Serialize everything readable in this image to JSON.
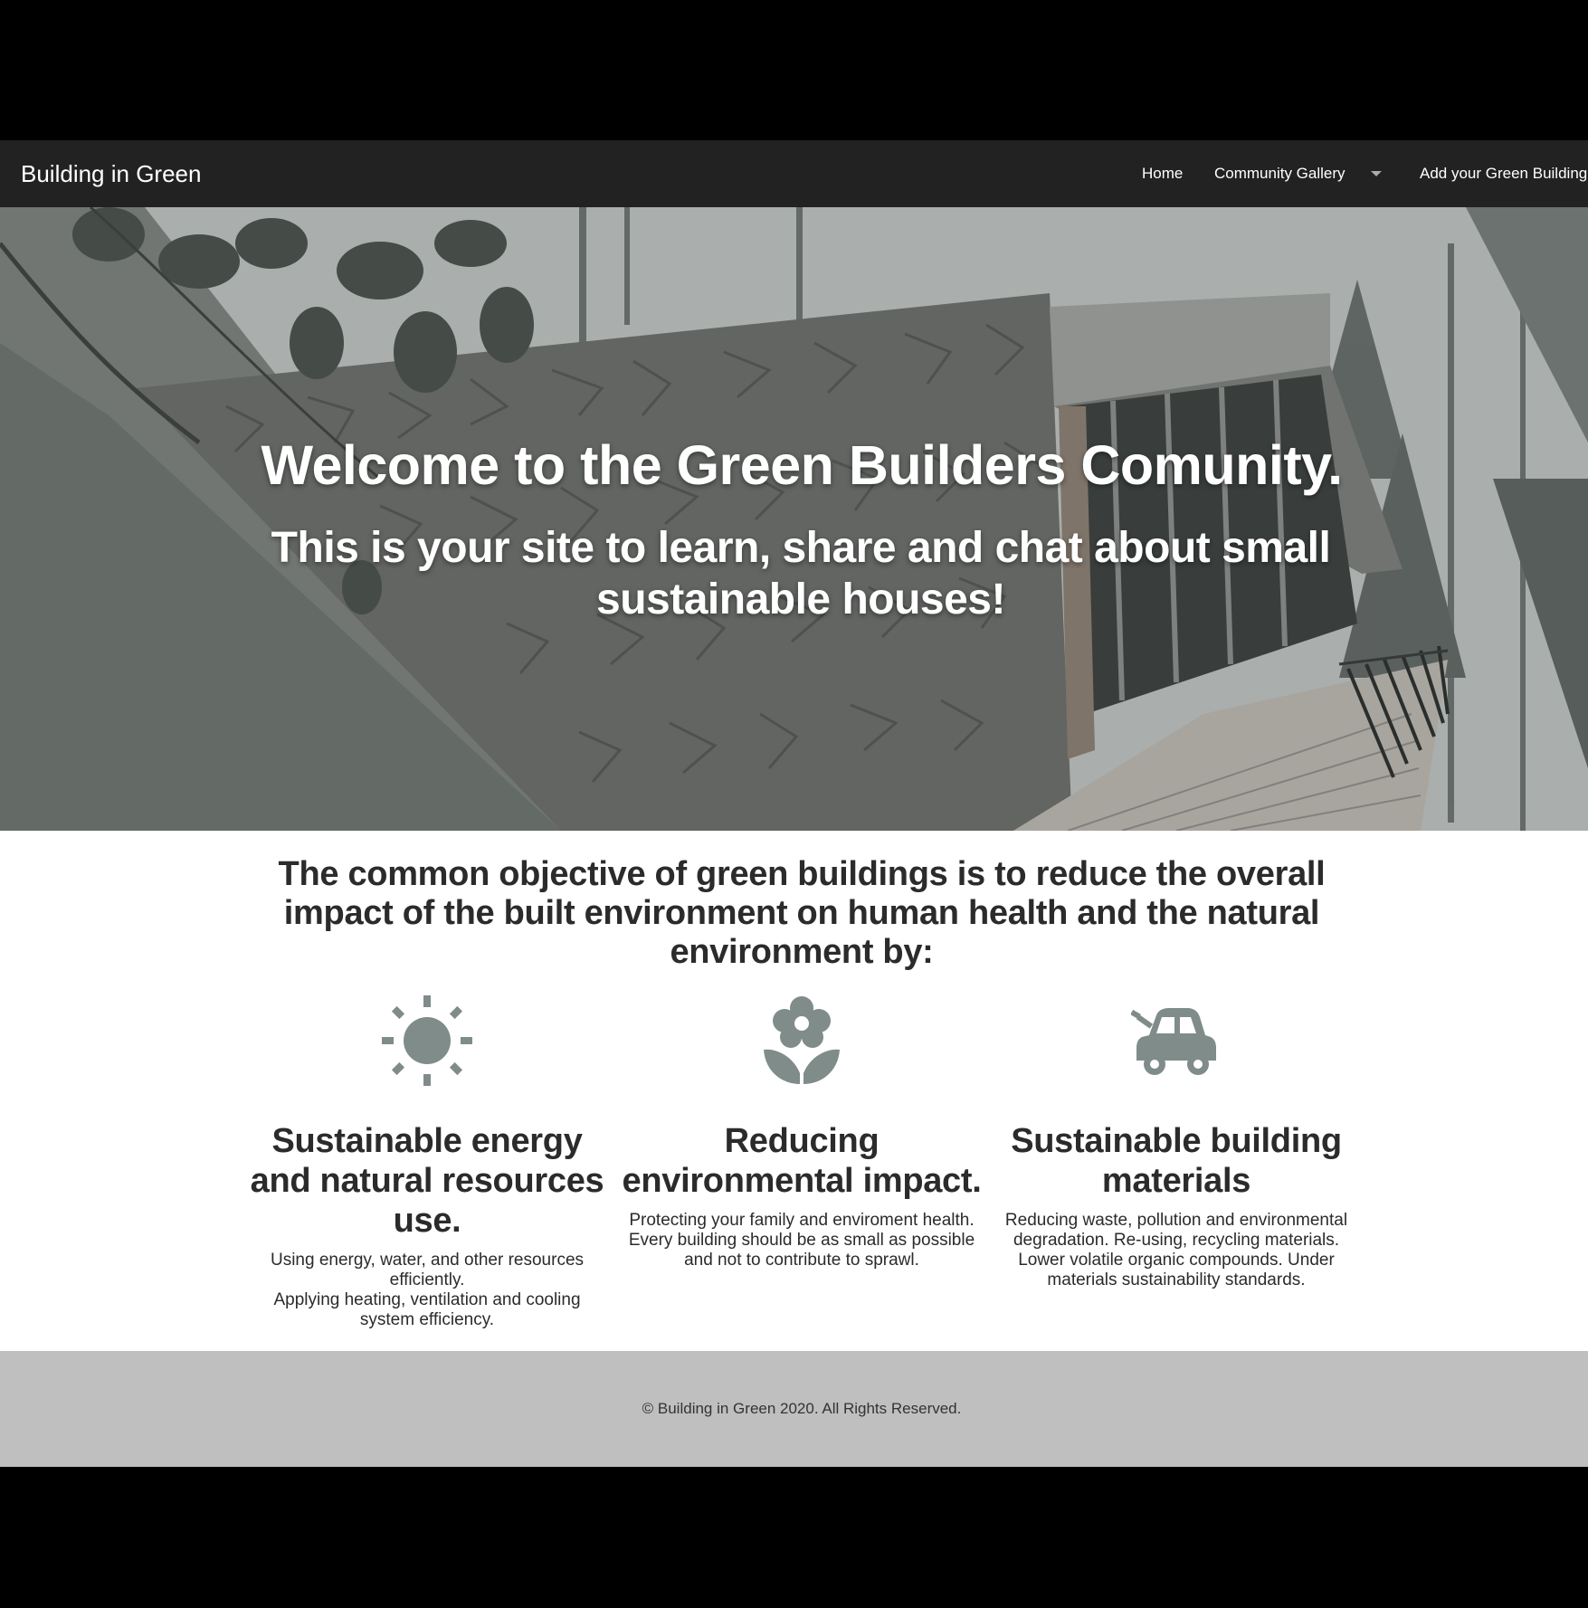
{
  "navbar": {
    "brand": "Building in Green",
    "items": [
      {
        "label": "Home"
      },
      {
        "label": "Community Gallery",
        "has_dropdown": true
      },
      {
        "label": "Add your Green Building"
      }
    ]
  },
  "hero": {
    "title": "Welcome to the Green Builders Comunity.",
    "subtitle": "This is your site to learn, share and chat about small sustainable houses!"
  },
  "intro": {
    "text": "The common objective of green buildings is to reduce the overall impact of the built environment on human health and the natural environment by:"
  },
  "features": [
    {
      "icon": "sun-icon",
      "title": "Sustainable energy and natural resources use.",
      "lines": [
        "Using energy, water, and other resources efficiently.",
        "Applying heating, ventilation and cooling system efficiency."
      ]
    },
    {
      "icon": "flower-icon",
      "title": "Reducing environmental impact.",
      "lines": [
        "Protecting your family and enviroment health.",
        "Every building should be as small as possible and not to contribute to sprawl."
      ]
    },
    {
      "icon": "car-icon",
      "title": "Sustainable building materials",
      "lines": [
        "Reducing waste, pollution and environmental degradation. Re-using, recycling materials.",
        "Lower volatile organic compounds. Under materials sustainability standards."
      ]
    }
  ],
  "footer": {
    "text": "© Building in Green 2020. All Rights Reserved."
  },
  "colors": {
    "navbar_bg": "#222222",
    "icon": "#7f8c8a",
    "text": "#2b2b2b",
    "footer_bg": "#bfbfbf"
  }
}
